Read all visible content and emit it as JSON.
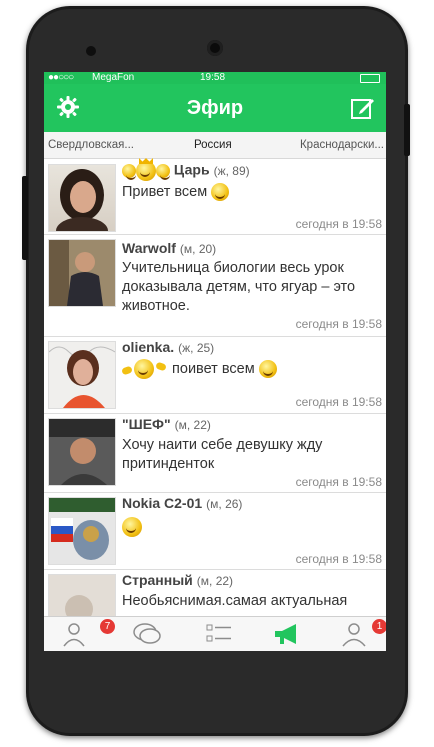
{
  "status": {
    "carrier": "MegaFon",
    "signal": "●●○○○",
    "time": "19:58"
  },
  "header": {
    "title": "Эфир"
  },
  "regions": {
    "left": "Свердловская...",
    "center": "Россия",
    "right": "Краснодарски..."
  },
  "feed": [
    {
      "name": "Царь",
      "meta": "(ж, 89)",
      "message": "Привет всем",
      "time": "сегодня в 19:58"
    },
    {
      "name": "Warwolf",
      "meta": "(м, 20)",
      "message": "Учительница биологии весь урок доказывала детям, что ягуар – это животное.",
      "time": "сегодня в 19:58"
    },
    {
      "name": "olienka.",
      "meta": "(ж, 25)",
      "message": "поивет всем",
      "time": "сегодня в 19:58"
    },
    {
      "name": "\"ШЕФ\"",
      "meta": "(м, 22)",
      "message": "Хочу наити себе девушку жду притинденток",
      "time": "сегодня в 19:58"
    },
    {
      "name": "Nokia C2-01",
      "meta": "(м, 26)",
      "message": "",
      "time": "сегодня в 19:58"
    },
    {
      "name": "Странный",
      "meta": "(м, 22)",
      "message": "Необьяснимая.самая актуальная",
      "time": ""
    }
  ],
  "tabbar": {
    "contacts_badge": "7",
    "profile_badge": "1"
  },
  "colors": {
    "accent": "#22c55e",
    "badge": "#e53935"
  },
  "icons": [
    "gear-icon",
    "compose-icon",
    "contacts-icon",
    "chat-icon",
    "list-icon",
    "megaphone-icon",
    "profile-icon"
  ]
}
